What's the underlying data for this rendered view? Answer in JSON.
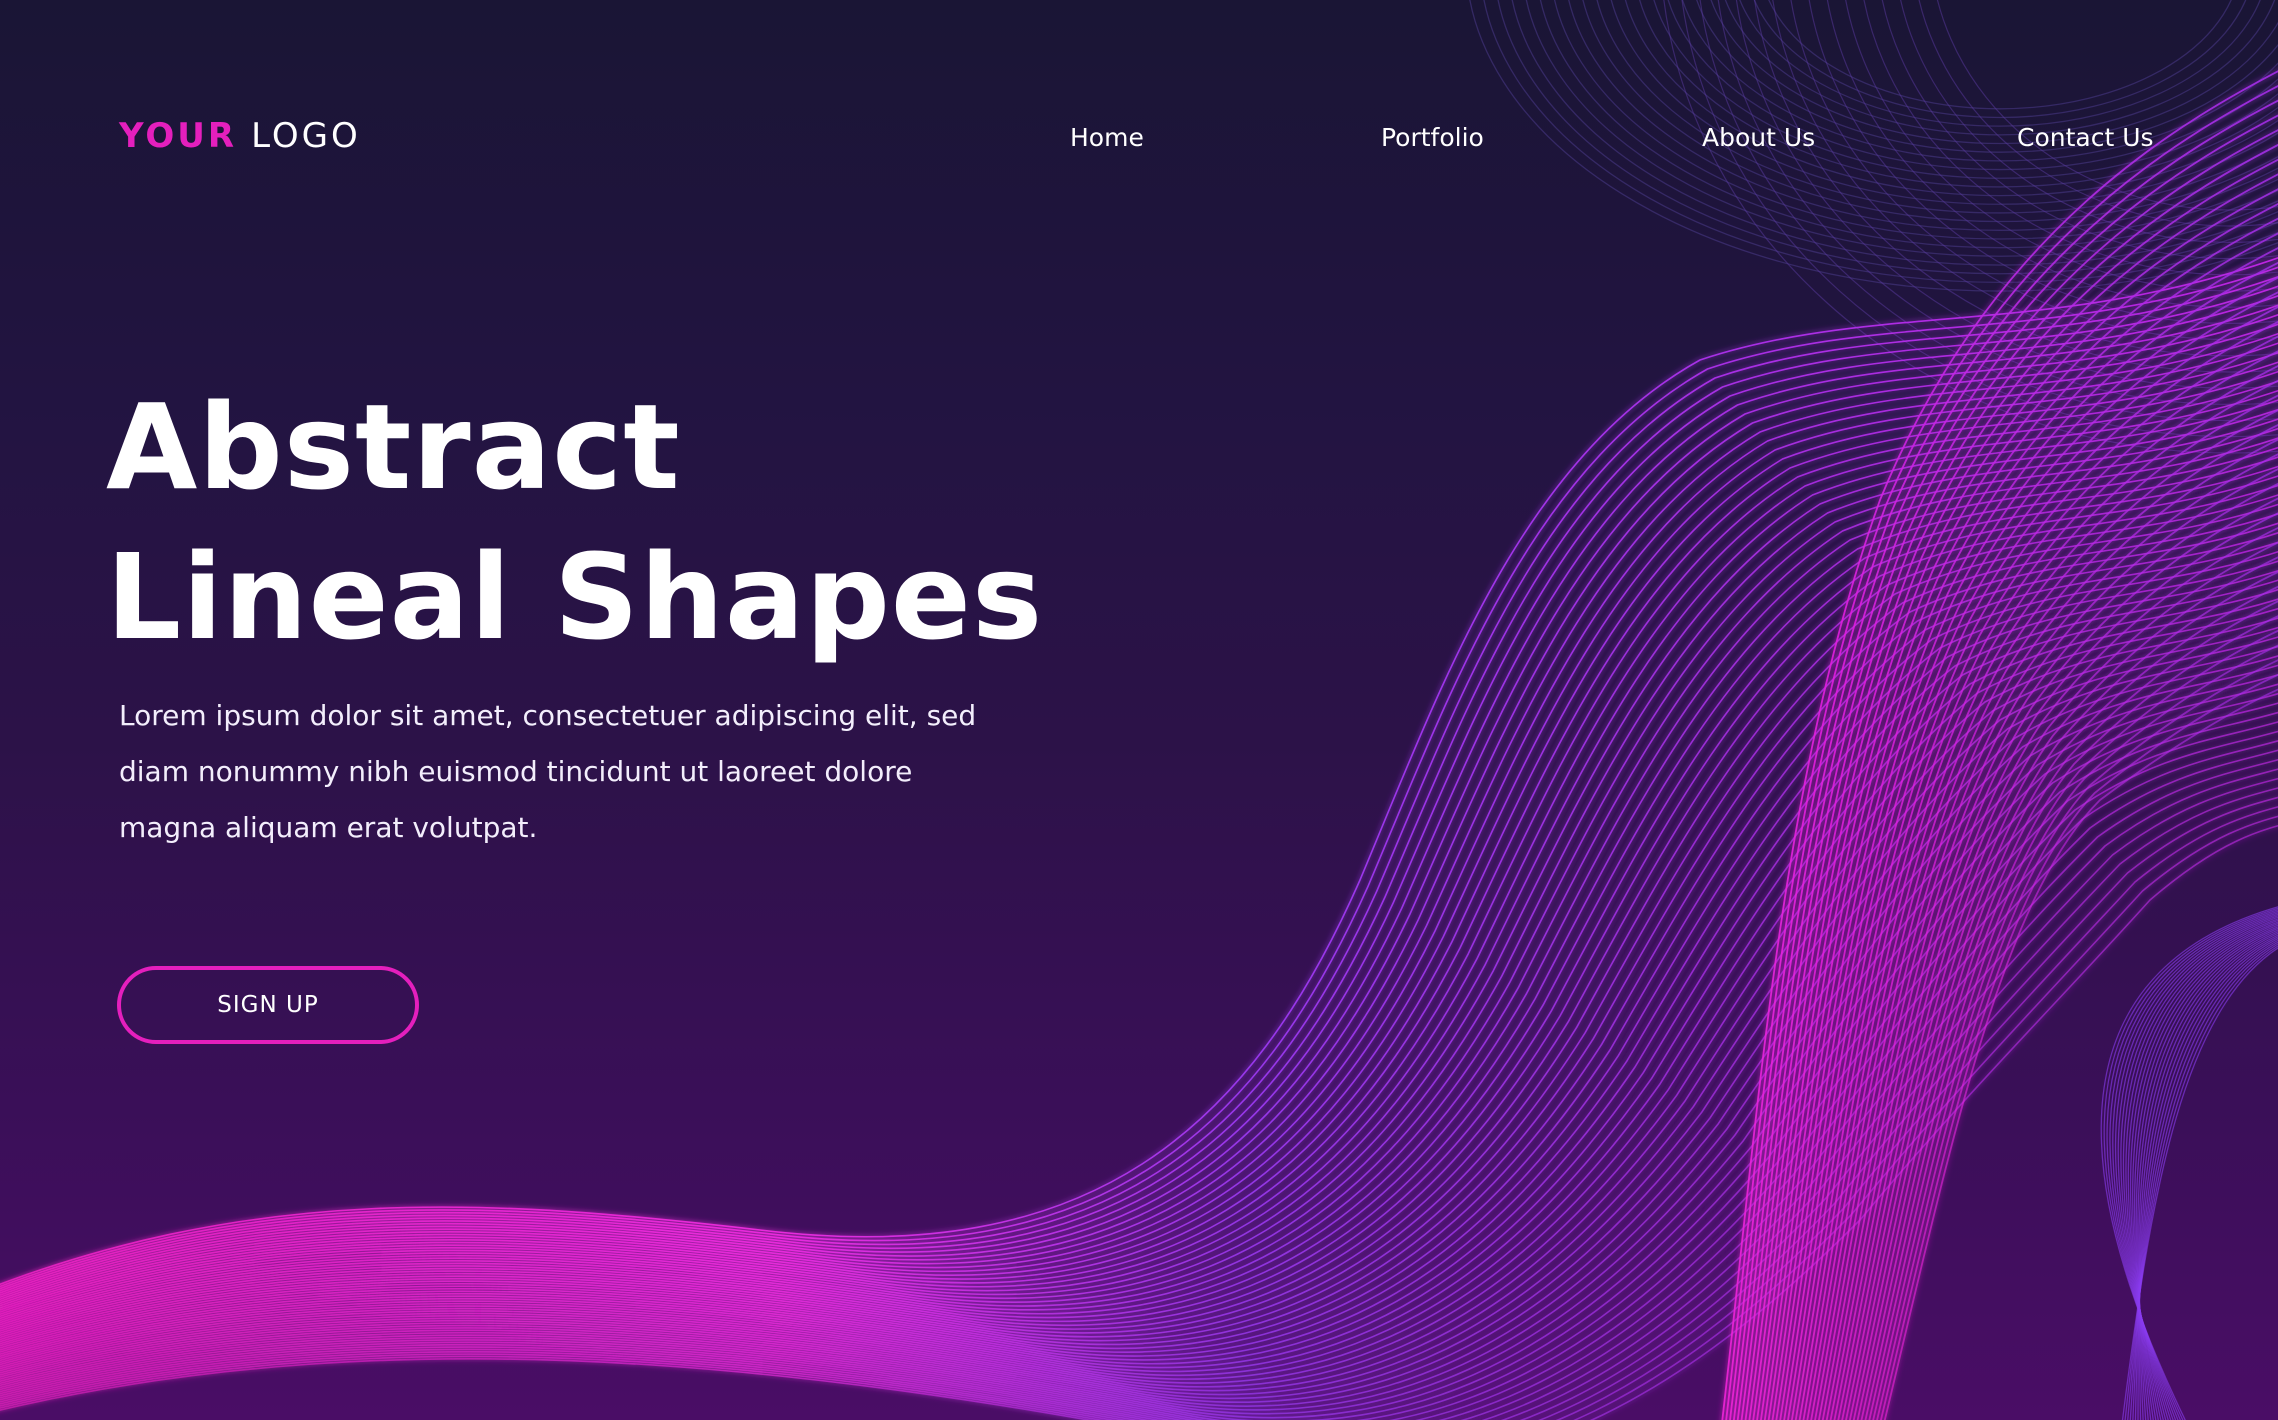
{
  "logo": {
    "strong": "YOUR",
    "light": "LOGO"
  },
  "nav": {
    "home": "Home",
    "portfolio": "Portfolio",
    "about": "About Us",
    "contact": "Contact Us"
  },
  "hero": {
    "title_line1": "Abstract",
    "title_line2": "Lineal Shapes",
    "body": "Lorem ipsum dolor sit amet, consectetuer adipiscing elit, sed diam nonummy nibh euismod tincidunt ut laoreet dolore magna aliquam erat volutpat.",
    "cta_label": "SIGN UP"
  },
  "colors": {
    "background_top": "#1a1535",
    "background_bottom": "#4a0d66",
    "accent_magenta": "#e41fbd",
    "accent_violet": "#8a3cf0",
    "text": "#ffffff"
  }
}
